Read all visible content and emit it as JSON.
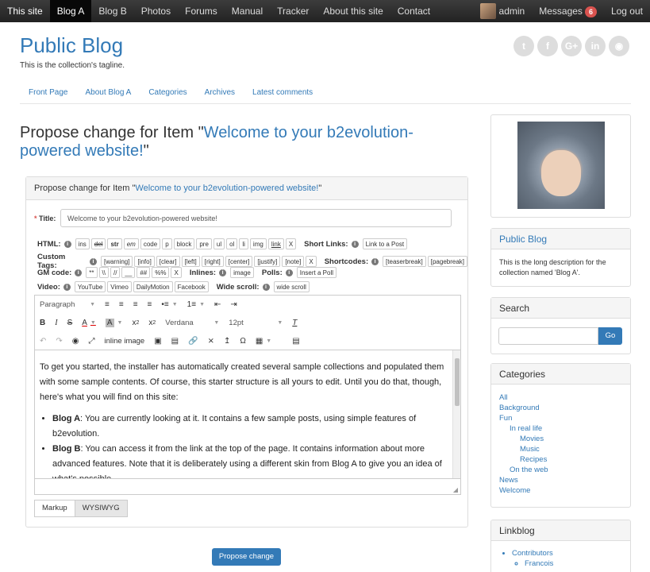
{
  "topbar": {
    "left": [
      "This site",
      "Blog A",
      "Blog B",
      "Photos",
      "Forums",
      "Manual",
      "Tracker",
      "About this site",
      "Contact"
    ],
    "user": "admin",
    "messages_label": "Messages",
    "messages_count": "6",
    "logout": "Log out"
  },
  "header": {
    "title": "Public Blog",
    "tagline": "This is the collection's tagline.",
    "social_icons": [
      "twitter-icon",
      "facebook-icon",
      "google-plus-icon",
      "linkedin-icon",
      "github-icon"
    ],
    "nav": [
      "Front Page",
      "About Blog A",
      "Categories",
      "Archives",
      "Latest comments"
    ]
  },
  "main": {
    "title_prefix": "Propose change for Item \"",
    "title_link": "Welcome to your b2evolution-powered website!",
    "title_suffix": "\"",
    "panel_prefix": "Propose change for Item \"",
    "panel_link": "Welcome to your b2evolution-powered website!",
    "panel_suffix": "\"",
    "title_label": "Title:",
    "title_required": "*",
    "title_value": "Welcome to your b2evolution-powered website!",
    "toolbars": {
      "html_label": "HTML:",
      "html_buttons": [
        "ins",
        "del",
        "str",
        "em",
        "code",
        "p",
        "block",
        "pre",
        "ul",
        "ol",
        "li",
        "img",
        "link",
        "X"
      ],
      "short_links_label": "Short Links:",
      "short_links_buttons": [
        "Link to a Post"
      ],
      "custom_tags_label": "Custom Tags:",
      "custom_tags_buttons": [
        "[warning]",
        "[info]",
        "[clear]",
        "[left]",
        "[right]",
        "[center]",
        "[justify]",
        "[note]",
        "X"
      ],
      "shortcodes_label": "Shortcodes:",
      "shortcodes_buttons": [
        "[teaserbreak]",
        "[pagebreak]"
      ],
      "gm_label": "GM code:",
      "gm_buttons": [
        "**",
        "\\\\",
        "//",
        "__",
        "##",
        "%%",
        "X"
      ],
      "inlines_label": "Inlines:",
      "inlines_buttons": [
        "image"
      ],
      "polls_label": "Polls:",
      "polls_buttons": [
        "Insert a Poll"
      ],
      "video_label": "Video:",
      "video_buttons": [
        "YouTube",
        "Vimeo",
        "DailyMotion",
        "Facebook"
      ],
      "wide_label": "Wide scroll:",
      "wide_buttons": [
        "wide scroll"
      ]
    },
    "editor": {
      "format": "Paragraph",
      "font": "Verdana",
      "size": "12pt",
      "inline_image": "inline image",
      "content_intro": "To get you started, the installer has automatically created several sample collections and populated them with some sample contents. Of course, this starter structure is all yours to edit. Until you do that, though, here's what you will find on this site:",
      "items": [
        {
          "strong": "Blog A",
          "text": ": You are currently looking at it. It contains a few sample posts, using simple features of b2evolution."
        },
        {
          "strong": "Blog B",
          "text": ": You can access it from the link at the top of the page. It contains information about more advanced features. Note that it is deliberately using a different skin from Blog A to give you an idea of what's possible."
        }
      ]
    },
    "modes": [
      "Markup",
      "WYSIWYG"
    ],
    "submit": "Propose change"
  },
  "sidebar": {
    "blog_title": "Public Blog",
    "blog_desc": "This is the long description for the collection named 'Blog A'.",
    "search_title": "Search",
    "search_button": "Go",
    "categories_title": "Categories",
    "categories": [
      "All",
      "Background",
      "Fun",
      "In real life",
      "Movies",
      "Music",
      "Recipes",
      "On the web",
      "News",
      "Welcome"
    ],
    "linkblog_title": "Linkblog",
    "linkblog_items": [
      "Contributors",
      "Francois"
    ]
  },
  "colors": {
    "accent": "#337ab7",
    "badge": "#d9534f",
    "topbar": "#222222"
  }
}
